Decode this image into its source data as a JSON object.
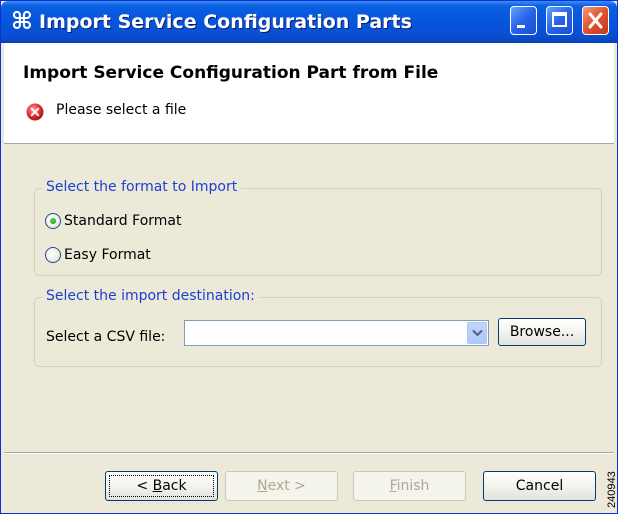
{
  "window": {
    "title": "Import Service Configuration Parts",
    "app_icon": "⌘"
  },
  "banner": {
    "title": "Import Service Configuration Part from File",
    "message": "Please select a file",
    "message_icon": "error-icon"
  },
  "format_group": {
    "legend": "Select the format to Import",
    "options": [
      {
        "label": "Standard Format",
        "selected": true
      },
      {
        "label": "Easy Format",
        "selected": false
      }
    ]
  },
  "destination_group": {
    "legend": "Select the import destination:",
    "csv_label": "Select a CSV file:",
    "csv_value": "",
    "browse_label": "Browse..."
  },
  "buttons": {
    "back": {
      "mnemonic": "B",
      "rest": "ack",
      "prefix": "< ",
      "enabled": true
    },
    "next": {
      "mnemonic": "N",
      "rest": "ext >",
      "prefix": "",
      "enabled": false
    },
    "finish": {
      "mnemonic": "F",
      "rest": "inish",
      "prefix": "",
      "enabled": false
    },
    "cancel": {
      "label": "Cancel",
      "enabled": true
    }
  },
  "figure_number": "240943",
  "colors": {
    "titlebar": "#0855dd",
    "dialog_bg": "#ece9d8",
    "legend_text": "#1c3ed3",
    "close_button": "#e0502c",
    "error_icon": "#d62b2b"
  }
}
